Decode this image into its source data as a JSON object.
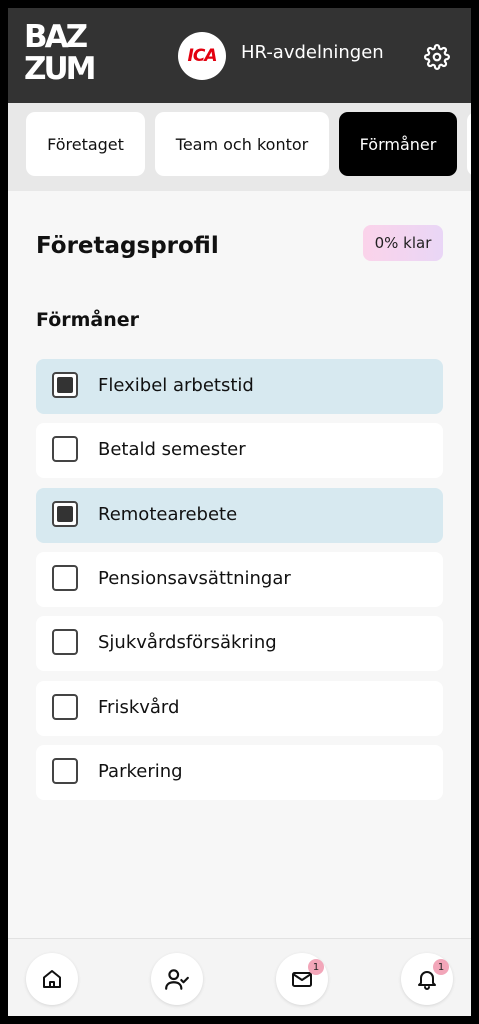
{
  "app": {
    "logo_text_line1": "BAZ",
    "logo_text_line2": "ZUM",
    "company_logo_text": "ICA",
    "department": "HR-avdelningen",
    "settings_icon": "gear-icon",
    "colors": {
      "header_bg": "#333333",
      "active_tab_bg": "#000000",
      "checked_row_bg": "#d7e9f0",
      "company_logo_red": "#e3000f"
    }
  },
  "tabs": [
    {
      "label": "Företaget",
      "active": false
    },
    {
      "label": "Team och kontor",
      "active": false
    },
    {
      "label": "Förmåner",
      "active": true
    }
  ],
  "profile": {
    "title": "Företagsprofil",
    "progress_label": "0% klar",
    "progress_percent": 0
  },
  "benefits": {
    "section_title": "Förmåner",
    "items": [
      {
        "label": "Flexibel arbetstid",
        "checked": true
      },
      {
        "label": "Betald semester",
        "checked": false
      },
      {
        "label": "Remotearebete",
        "checked": true
      },
      {
        "label": "Pensionsavsättningar",
        "checked": false
      },
      {
        "label": "Sjukvårdsförsäkring",
        "checked": false
      },
      {
        "label": "Friskvård",
        "checked": false
      },
      {
        "label": "Parkering",
        "checked": false
      }
    ]
  },
  "bottom_nav": {
    "items": [
      {
        "icon": "home-icon",
        "badge": ""
      },
      {
        "icon": "user-check-icon",
        "badge": ""
      },
      {
        "icon": "mail-icon",
        "badge": "1"
      },
      {
        "icon": "bell-icon",
        "badge": "1"
      }
    ]
  }
}
